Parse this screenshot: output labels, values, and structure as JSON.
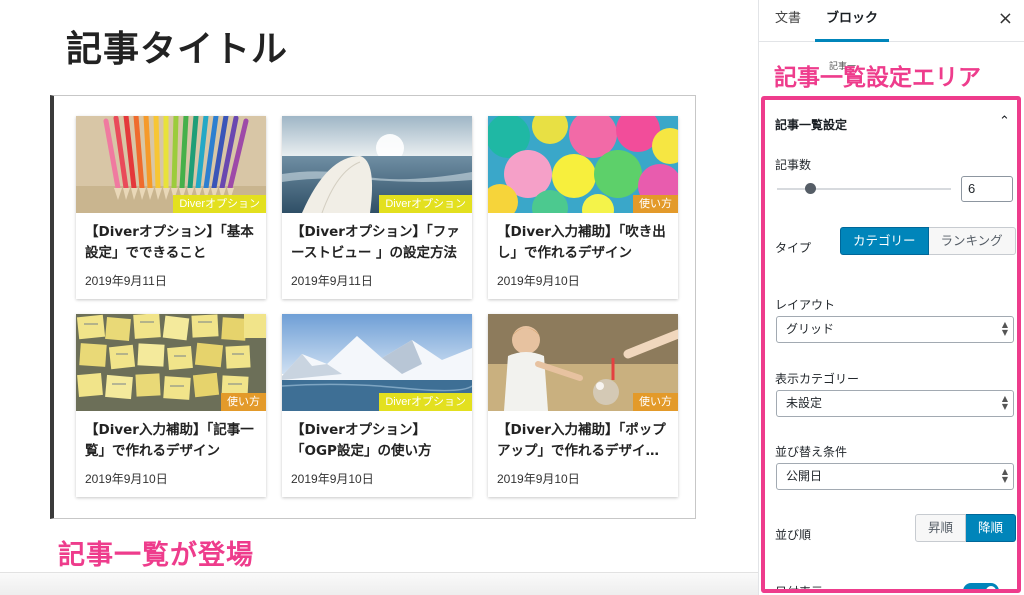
{
  "editor": {
    "page_title": "記事タイトル",
    "caption": "記事一覧が登場",
    "cards": [
      {
        "title": "【Diverオプション】「基本設定」でできること",
        "date": "2019年9月11日",
        "badge": "Diverオプション",
        "badge_color": "#e3e01f",
        "image": "colored-pencils"
      },
      {
        "title": "【Diverオプション】「ファーストビュー 」の設定方法",
        "date": "2019年9月11日",
        "badge": "Diverオプション",
        "badge_color": "#e3e01f",
        "image": "surfboard-sea"
      },
      {
        "title": "【Diver入力補助】「吹き出し」で作れるデザイン",
        "date": "2019年9月10日",
        "badge": "使い方",
        "badge_color": "#e39a2a",
        "image": "balloons"
      },
      {
        "title": "【Diver入力補助】「記事一覧」で作れるデザイン",
        "date": "2019年9月10日",
        "badge": "使い方",
        "badge_color": "#e39a2a",
        "image": "sticky-notes"
      },
      {
        "title": "【Diverオプション】「OGP設定」の使い方",
        "date": "2019年9月10日",
        "badge": "Diverオプション",
        "badge_color": "#e3e01f",
        "image": "snowy-mountains"
      },
      {
        "title": "【Diver入力補助】「ポップアップ」で作れるデザイ…",
        "date": "2019年9月10日",
        "badge": "使い方",
        "badge_color": "#e39a2a",
        "image": "child-water-balloon"
      }
    ]
  },
  "sidebar": {
    "tabs": {
      "document": "文書",
      "block": "ブロック"
    },
    "close_label": "×",
    "tiny_label": "記事一",
    "caption": "記事一覧設定エリア",
    "panel_title": "記事一覧設定",
    "count_label": "記事数",
    "count_value": "6",
    "type_label": "タイプ",
    "type_options": [
      "カテゴリー",
      "ランキング"
    ],
    "type_selected": "カテゴリー",
    "layout_label": "レイアウト",
    "layout_value": "グリッド",
    "category_label": "表示カテゴリー",
    "category_value": "未設定",
    "sort_label": "並び替え条件",
    "sort_value": "公開日",
    "order_label": "並び順",
    "order_options": [
      "昇順",
      "降順"
    ],
    "order_selected": "降順",
    "date_label": "日付表示"
  },
  "colors": {
    "accent": "#0085ba",
    "highlight": "#ee3c8c"
  }
}
